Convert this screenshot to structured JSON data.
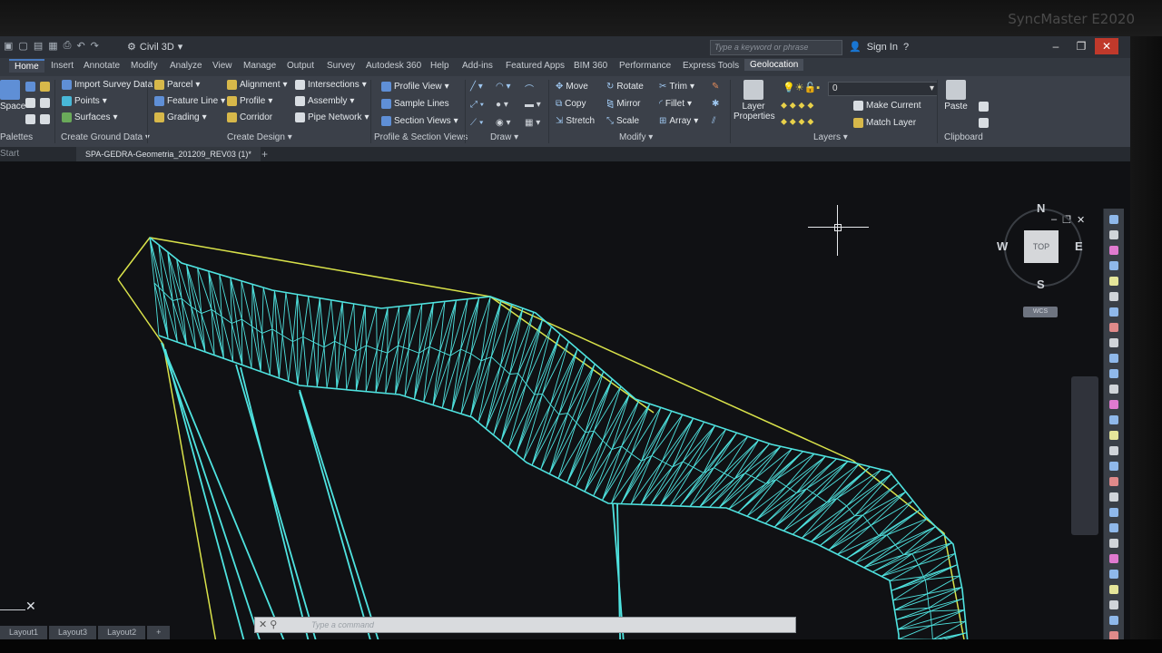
{
  "monitor": {
    "brand": "SyncMaster E2020"
  },
  "titlebar": {
    "workspace": "Civil 3D",
    "search_placeholder": "Type a keyword or phrase",
    "sign_in": "Sign In"
  },
  "tabs": [
    "Home",
    "Insert",
    "Annotate",
    "Modify",
    "Analyze",
    "View",
    "Manage",
    "Output",
    "Survey",
    "Autodesk 360",
    "Help",
    "Add-ins",
    "Featured Apps",
    "BIM 360",
    "Performance",
    "Express Tools",
    "Geolocation"
  ],
  "ribbon": {
    "ground_data": {
      "items": [
        "Import Survey Data",
        "Points",
        "Surfaces"
      ],
      "label": "Create Ground Data"
    },
    "design": {
      "items": [
        "Parcel",
        "Feature Line",
        "Grading",
        "Alignment",
        "Profile",
        "Corridor",
        "Intersections",
        "Assembly",
        "Pipe Network"
      ],
      "label": "Create Design"
    },
    "profile_section": {
      "items": [
        "Profile View",
        "Sample Lines",
        "Section Views"
      ],
      "label": "Profile & Section Views"
    },
    "draw": {
      "label": "Draw"
    },
    "modify": {
      "items": [
        "Move",
        "Rotate",
        "Trim",
        "Copy",
        "Mirror",
        "Fillet",
        "Stretch",
        "Scale",
        "Array"
      ],
      "label": "Modify"
    },
    "layers": {
      "layer_properties": "Layer Properties",
      "current_layer": "0",
      "make_current": "Make Current",
      "match_layer": "Match Layer",
      "label": "Layers"
    },
    "clipboard": {
      "paste": "Paste",
      "label": "Clipboard"
    },
    "palettes_label": "Palettes",
    "space_label": "Space"
  },
  "document": {
    "start_tab": "Start",
    "active_tab": "SPA-GEDRA-Geometria_201209_REV03 (1)*"
  },
  "viewcube": {
    "top": "TOP",
    "n": "N",
    "s": "S",
    "e": "E",
    "w": "W",
    "wcs": "WCS"
  },
  "command_line": {
    "placeholder": "Type a command"
  },
  "layout_tabs": [
    "Layout1",
    "Layout3",
    "Layout2"
  ],
  "colors": {
    "tin": "#4fe3e0",
    "boundary": "#d9e24a",
    "accent": "#4a7bc0"
  }
}
